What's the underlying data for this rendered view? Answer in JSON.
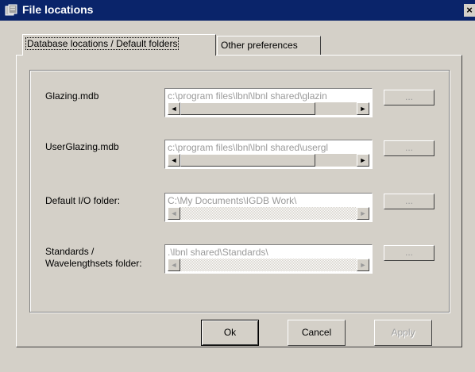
{
  "window": {
    "title": "File locations",
    "close_label": "×"
  },
  "tabs": [
    {
      "label": "Database locations / Default folders"
    },
    {
      "label": "Other preferences"
    }
  ],
  "rows": [
    {
      "label": "Glazing.mdb",
      "value": "c:\\program files\\lbnl\\lbnl shared\\glazin",
      "browse_label": "..."
    },
    {
      "label": "UserGlazing.mdb",
      "value": "c:\\program files\\lbnl\\lbnl shared\\usergl",
      "browse_label": "..."
    },
    {
      "label": "Default I/O folder:",
      "value": "C:\\My Documents\\IGDB Work\\",
      "browse_label": "..."
    },
    {
      "label_line1": "Standards /",
      "label_line2": "Wavelengthsets folder:",
      "value": ".\\lbnl shared\\Standards\\",
      "browse_label": "..."
    }
  ],
  "buttons": {
    "ok": "Ok",
    "cancel": "Cancel",
    "apply": "Apply"
  },
  "icons": {
    "scroll_left": "◄",
    "scroll_right": "►"
  }
}
